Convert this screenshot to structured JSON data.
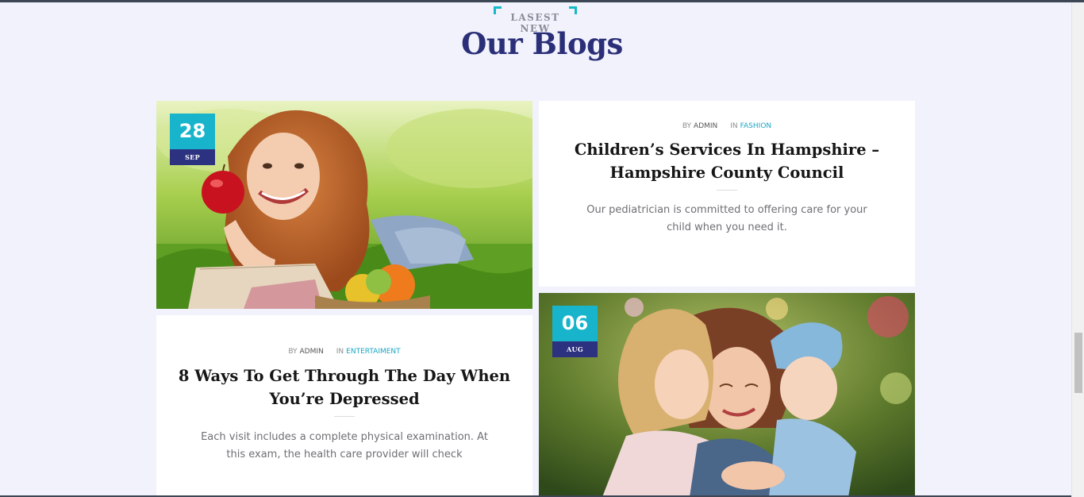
{
  "section": {
    "tag": "LASEST NEW",
    "title": "Our Blogs"
  },
  "posts": [
    {
      "day": "28",
      "month": "SEP",
      "image": "woman-with-apple-photo"
    },
    {
      "by_label": "BY",
      "author": "ADMIN",
      "in_label": "IN",
      "category": "FASHION",
      "title_line1": "Children’s Services In Hampshire –",
      "title_line2": "Hampshire County Council",
      "excerpt_line1": "Our pediatrician is committed to offering care for your",
      "excerpt_line2": "child when you need it."
    },
    {
      "by_label": "BY",
      "author": "ADMIN",
      "in_label": "IN",
      "category": "ENTERTAIMENT",
      "title_line1": "8 Ways To Get Through The Day When",
      "title_line2": "You’re Depressed",
      "excerpt_line1": "Each visit includes a complete physical examination. At",
      "excerpt_line2": "this exam, the health care provider will check"
    },
    {
      "day": "06",
      "month": "AUG",
      "image": "mother-with-children-photo"
    }
  ],
  "colors": {
    "accent": "#18b4cb",
    "navy": "#2c3180",
    "title": "#2a2f78",
    "background": "#f1f2fc"
  }
}
